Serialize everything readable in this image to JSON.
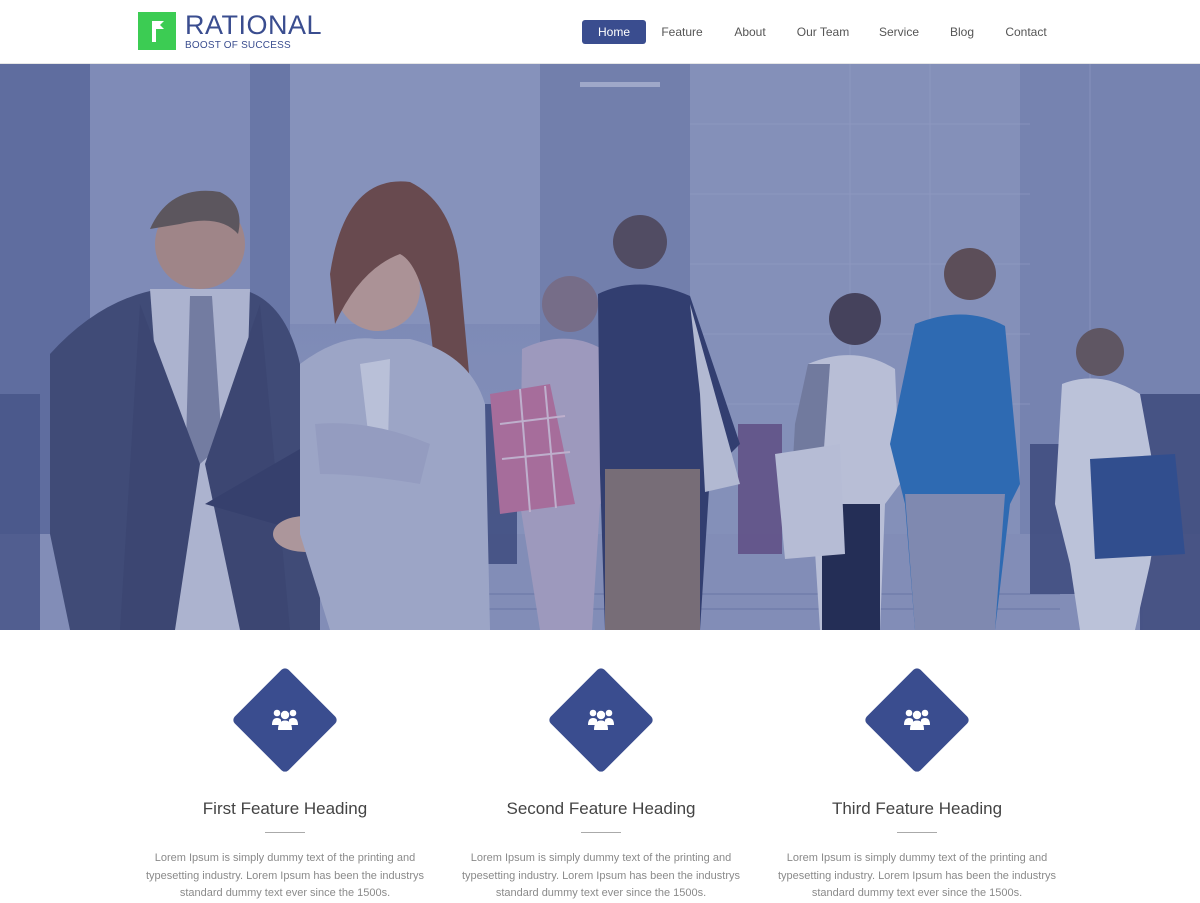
{
  "brand": {
    "name": "RATIONAL",
    "tagline": "BOOST OF SUCCESS",
    "accent_color": "#3ccc53",
    "primary_color": "#3a4d8f"
  },
  "nav": {
    "items": [
      {
        "label": "Home",
        "active": true
      },
      {
        "label": "Feature",
        "active": false
      },
      {
        "label": "About",
        "active": false
      },
      {
        "label": "Our Team",
        "active": false
      },
      {
        "label": "Service",
        "active": false
      },
      {
        "label": "Blog",
        "active": false
      },
      {
        "label": "Contact",
        "active": false
      }
    ]
  },
  "hero": {
    "image": "business-people-crowd-photo",
    "overlay_color": "#3a4d8f"
  },
  "features": [
    {
      "icon": "users-icon",
      "heading": "First Feature Heading",
      "text": "Lorem Ipsum is simply dummy text of the printing and typesetting industry. Lorem Ipsum has been the industrys standard dummy text ever since the 1500s."
    },
    {
      "icon": "users-icon",
      "heading": "Second Feature Heading",
      "text": "Lorem Ipsum is simply dummy text of the printing and typesetting industry. Lorem Ipsum has been the industrys standard dummy text ever since the 1500s."
    },
    {
      "icon": "users-icon",
      "heading": "Third Feature Heading",
      "text": "Lorem Ipsum is simply dummy text of the printing and typesetting industry. Lorem Ipsum has been the industrys standard dummy text ever since the 1500s."
    }
  ]
}
